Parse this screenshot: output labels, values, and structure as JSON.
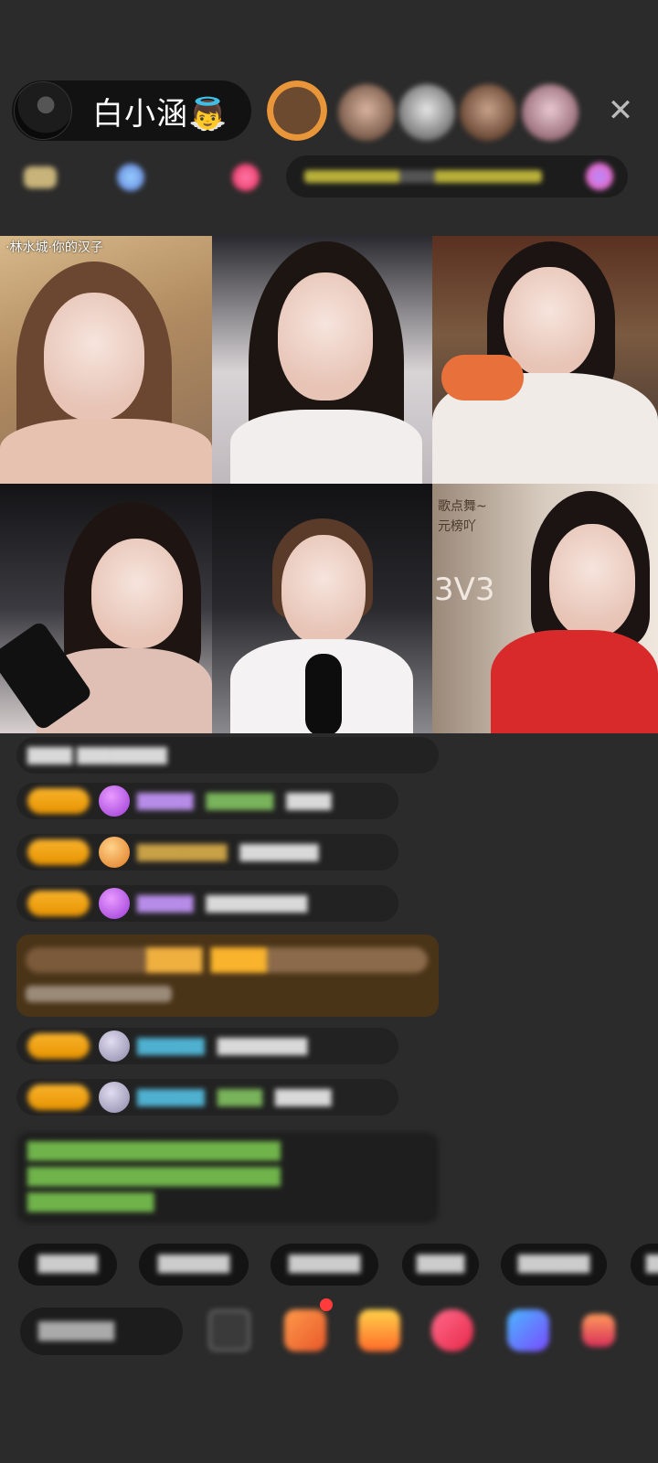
{
  "header": {
    "host_name": "白小涵👼",
    "close_glyph": "✕"
  },
  "video_grid": {
    "tiles": [
      {
        "caption": "·林水城·你的汉子"
      },
      {
        "caption": ""
      },
      {
        "caption": ""
      },
      {
        "caption": ""
      },
      {
        "caption": ""
      },
      {
        "caption_top": "歌点舞~",
        "caption_mid": "元榜吖",
        "badge": "3V3"
      }
    ]
  },
  "colors": {
    "background": "#2b2b2b",
    "tag_gold": "#f9b32c",
    "notice_green": "#6fb34a",
    "gift_highlight": "#4a3418"
  }
}
